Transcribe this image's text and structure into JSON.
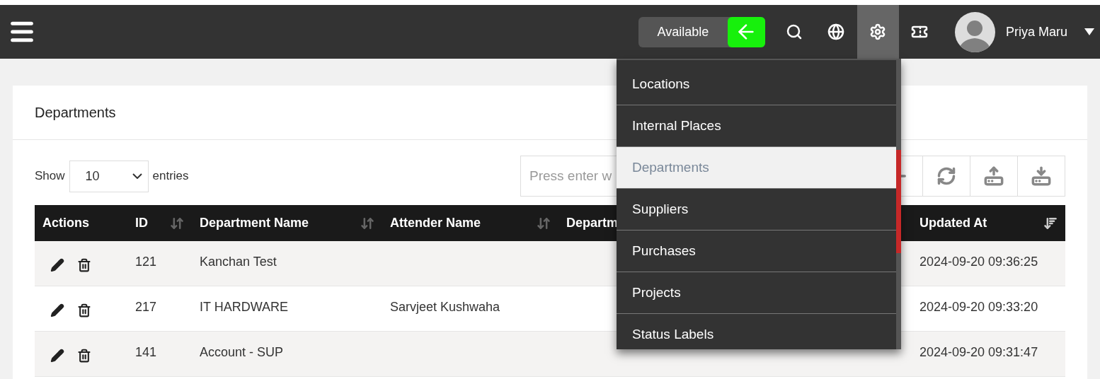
{
  "topbar": {
    "status": {
      "label": "Available"
    },
    "icons": [
      {
        "kind": "search",
        "selected": false
      },
      {
        "kind": "globe",
        "selected": false
      },
      {
        "kind": "settings",
        "selected": true
      },
      {
        "kind": "ticket",
        "selected": false
      }
    ],
    "user": {
      "name": "Priya Maru"
    }
  },
  "settings_menu": {
    "items": [
      {
        "label": "Locations",
        "selected": false
      },
      {
        "label": "Internal Places",
        "selected": false
      },
      {
        "label": "Departments",
        "selected": true
      },
      {
        "label": "Suppliers",
        "selected": false
      },
      {
        "label": "Purchases",
        "selected": false
      },
      {
        "label": "Projects",
        "selected": false
      },
      {
        "label": "Status Labels",
        "selected": false
      }
    ]
  },
  "card": {
    "title": "Departments",
    "length": {
      "before": "Show",
      "value": "10",
      "after": "entries"
    },
    "search": {
      "placeholder": "Press enter w"
    },
    "tools": [
      {
        "kind": "add"
      },
      {
        "kind": "refresh"
      },
      {
        "kind": "upload"
      },
      {
        "kind": "download"
      }
    ],
    "table": {
      "columns": [
        {
          "label": "Actions",
          "kind": "plain"
        },
        {
          "label": "ID",
          "kind": "sortable"
        },
        {
          "label": "Department Name",
          "kind": "sortable"
        },
        {
          "label": "Attender Name",
          "kind": "sortable"
        },
        {
          "label": "Departm",
          "kind": "plain"
        },
        {
          "label": "Updated At",
          "kind": "sorted"
        }
      ],
      "rows": [
        {
          "id": "121",
          "department_name": "Kanchan Test",
          "updated_at": "2024-09-20 09:36:25"
        },
        {
          "id": "217",
          "department_name": "IT HARDWARE",
          "attender_name": "Sarvjeet Kushwaha",
          "updated_at": "2024-09-20 09:33:20"
        },
        {
          "id": "141",
          "department_name": "Account - SUP",
          "updated_at": "2024-09-20 09:31:47"
        }
      ]
    }
  }
}
